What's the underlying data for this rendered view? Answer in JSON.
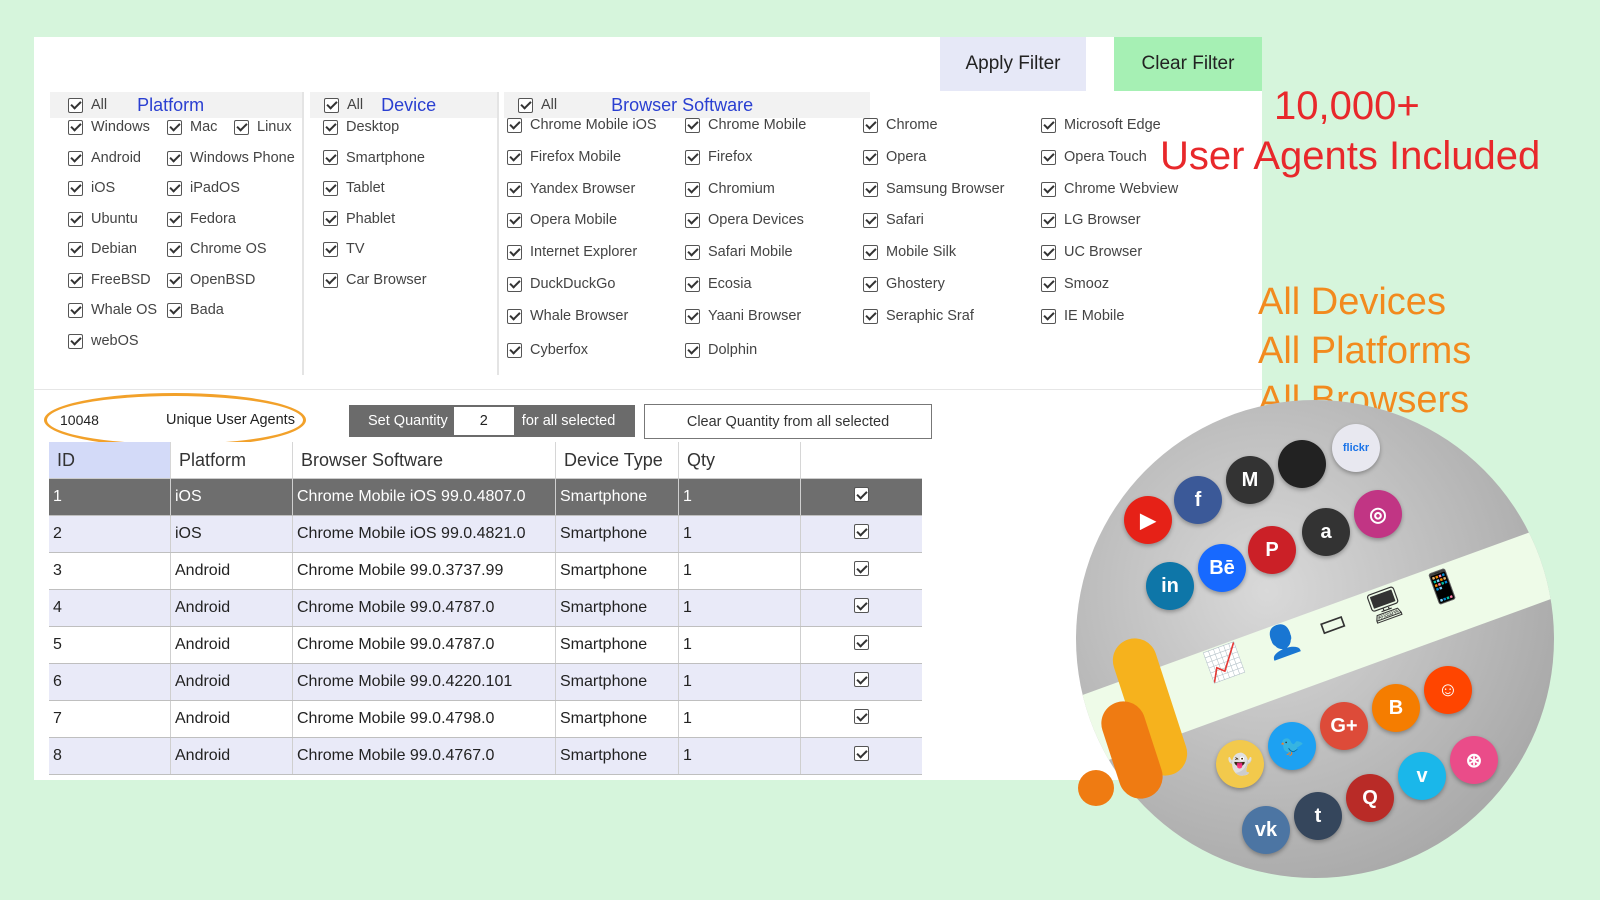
{
  "buttons": {
    "apply": "Apply Filter",
    "clear": "Clear Filter"
  },
  "platform": {
    "all": "All",
    "title": "Platform",
    "items": [
      "Windows",
      "Mac",
      "Linux",
      "Android",
      "Windows Phone",
      "iOS",
      "iPadOS",
      "Ubuntu",
      "Fedora",
      "Debian",
      "Chrome OS",
      "FreeBSD",
      "OpenBSD",
      "Whale OS",
      "Bada",
      "webOS"
    ]
  },
  "device": {
    "all": "All",
    "title": "Device",
    "items": [
      "Desktop",
      "Smartphone",
      "Tablet",
      "Phablet",
      "TV",
      "Car Browser"
    ]
  },
  "browser": {
    "all": "All",
    "title": "Browser Software",
    "items": [
      "Chrome Mobile iOS",
      "Chrome Mobile",
      "Chrome",
      "Microsoft Edge",
      "Firefox Mobile",
      "Firefox",
      "Opera",
      "Opera Touch",
      "Yandex Browser",
      "Chromium",
      "Samsung Browser",
      "Chrome Webview",
      "Opera Mobile",
      "Opera Devices",
      "Safari",
      "LG Browser",
      "Internet Explorer",
      "Safari Mobile",
      "Mobile Silk",
      "UC Browser",
      "DuckDuckGo",
      "Ecosia",
      "Ghostery",
      "Smooz",
      "Whale Browser",
      "Yaani Browser",
      "Seraphic Sraf",
      "IE Mobile",
      "Cyberfox",
      "Dolphin"
    ]
  },
  "count": {
    "value": "10048",
    "label": "Unique User Agents"
  },
  "quantity": {
    "set_label": "Set Quantity",
    "value": "2",
    "suffix": "for all selected",
    "clear_label": "Clear Quantity from all selected"
  },
  "table": {
    "headers": [
      "ID",
      "Platform",
      "Browser Software",
      "Device Type",
      "Qty",
      ""
    ],
    "rows": [
      [
        "1",
        "iOS",
        "Chrome Mobile iOS 99.0.4807.0",
        "Smartphone",
        "1"
      ],
      [
        "2",
        "iOS",
        "Chrome Mobile iOS 99.0.4821.0",
        "Smartphone",
        "1"
      ],
      [
        "3",
        "Android",
        "Chrome Mobile 99.0.3737.99",
        "Smartphone",
        "1"
      ],
      [
        "4",
        "Android",
        "Chrome Mobile 99.0.4787.0",
        "Smartphone",
        "1"
      ],
      [
        "5",
        "Android",
        "Chrome Mobile 99.0.4787.0",
        "Smartphone",
        "1"
      ],
      [
        "6",
        "Android",
        "Chrome Mobile 99.0.4220.101",
        "Smartphone",
        "1"
      ],
      [
        "7",
        "Android",
        "Chrome Mobile 99.0.4798.0",
        "Smartphone",
        "1"
      ],
      [
        "8",
        "Android",
        "Chrome Mobile 99.0.4767.0",
        "Smartphone",
        "1"
      ]
    ]
  },
  "promo": {
    "line1": "10,000+",
    "line2": "User Agents Included",
    "features": [
      "All Devices",
      "All Platforms",
      "All Browsers"
    ],
    "accent_red": "#e8282b",
    "accent_orange": "#f28a1e"
  },
  "social_icons": [
    "youtube-icon",
    "facebook-icon",
    "medium-icon",
    "apple-icon",
    "flickr-icon",
    "linkedin-icon",
    "behance-icon",
    "pinterest-icon",
    "amazon-icon",
    "instagram-icon",
    "snapchat-icon",
    "twitter-icon",
    "google-plus-icon",
    "blogger-icon",
    "reddit-icon",
    "vk-icon",
    "tumblr-icon",
    "quora-icon",
    "vimeo-icon",
    "dribbble-icon"
  ],
  "social_glyphs": {
    "youtube-icon": "▶",
    "facebook-icon": "f",
    "medium-icon": "M",
    "apple-icon": "",
    "flickr-icon": "flickr",
    "linkedin-icon": "in",
    "behance-icon": "Bē",
    "pinterest-icon": "P",
    "amazon-icon": "a",
    "instagram-icon": "◎",
    "snapchat-icon": "👻",
    "twitter-icon": "🐦",
    "google-plus-icon": "G+",
    "blogger-icon": "B",
    "reddit-icon": "☺",
    "vk-icon": "vk",
    "tumblr-icon": "t",
    "quora-icon": "Q",
    "vimeo-icon": "v",
    "dribbble-icon": "⊛"
  }
}
